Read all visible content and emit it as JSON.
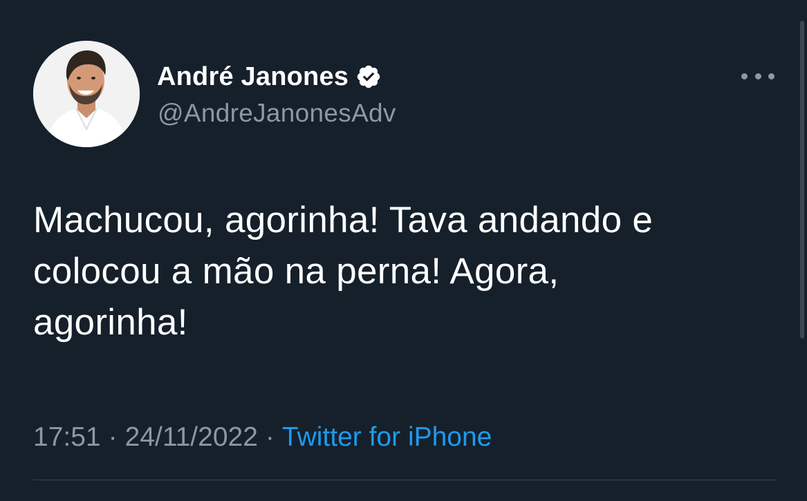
{
  "author": {
    "display_name": "André Janones",
    "handle": "@AndreJanonesAdv",
    "verified": true
  },
  "tweet": {
    "text_lines": [
      "Machucou, agorinha! Tava andando e",
      "colocou a mão na perna! Agora,",
      "agorinha!"
    ],
    "time": "17:51",
    "date": "24/11/2022",
    "separator": "·",
    "source": "Twitter for iPhone"
  },
  "icons": {
    "verified": "verified-badge-icon",
    "more": "more-options-icon"
  },
  "colors": {
    "background": "#15202b",
    "primary_text": "#ffffff",
    "secondary_text": "#8b98a5",
    "link": "#1d9bf0",
    "divider": "#38444d"
  }
}
